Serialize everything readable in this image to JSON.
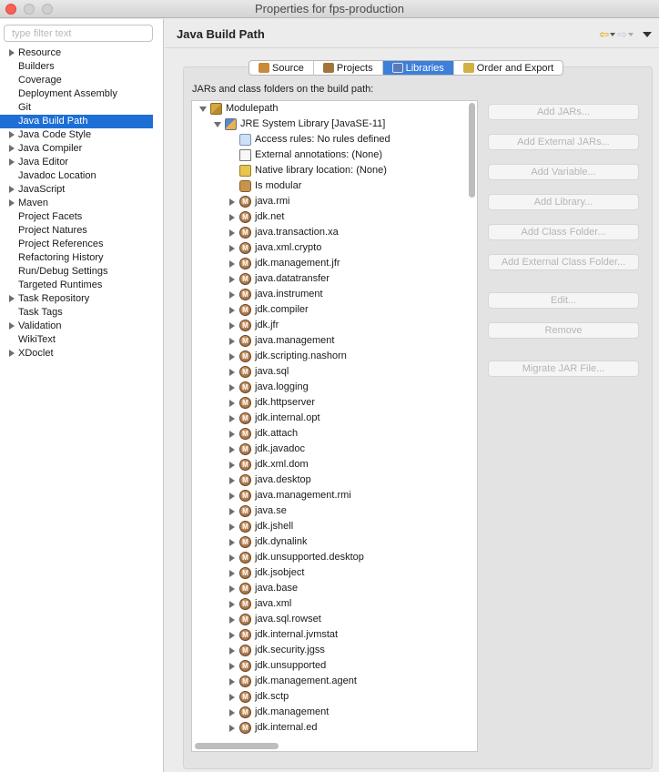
{
  "window": {
    "title": "Properties for fps-production"
  },
  "filter": {
    "placeholder": "type filter text",
    "value": ""
  },
  "nav": {
    "items": [
      {
        "label": "Resource",
        "expandable": true,
        "selected": false
      },
      {
        "label": "Builders",
        "expandable": false,
        "selected": false
      },
      {
        "label": "Coverage",
        "expandable": false,
        "selected": false
      },
      {
        "label": "Deployment Assembly",
        "expandable": false,
        "selected": false
      },
      {
        "label": "Git",
        "expandable": false,
        "selected": false
      },
      {
        "label": "Java Build Path",
        "expandable": false,
        "selected": true
      },
      {
        "label": "Java Code Style",
        "expandable": true,
        "selected": false
      },
      {
        "label": "Java Compiler",
        "expandable": true,
        "selected": false
      },
      {
        "label": "Java Editor",
        "expandable": true,
        "selected": false
      },
      {
        "label": "Javadoc Location",
        "expandable": false,
        "selected": false
      },
      {
        "label": "JavaScript",
        "expandable": true,
        "selected": false
      },
      {
        "label": "Maven",
        "expandable": true,
        "selected": false
      },
      {
        "label": "Project Facets",
        "expandable": false,
        "selected": false
      },
      {
        "label": "Project Natures",
        "expandable": false,
        "selected": false
      },
      {
        "label": "Project References",
        "expandable": false,
        "selected": false
      },
      {
        "label": "Refactoring History",
        "expandable": false,
        "selected": false
      },
      {
        "label": "Run/Debug Settings",
        "expandable": false,
        "selected": false
      },
      {
        "label": "Targeted Runtimes",
        "expandable": false,
        "selected": false
      },
      {
        "label": "Task Repository",
        "expandable": true,
        "selected": false
      },
      {
        "label": "Task Tags",
        "expandable": false,
        "selected": false
      },
      {
        "label": "Validation",
        "expandable": true,
        "selected": false
      },
      {
        "label": "WikiText",
        "expandable": false,
        "selected": false
      },
      {
        "label": "XDoclet",
        "expandable": true,
        "selected": false
      }
    ]
  },
  "page": {
    "title": "Java Build Path",
    "path_label": "JARs and class folders on the build path:"
  },
  "tabs": [
    {
      "label": "Source",
      "icon": "source-folder-icon",
      "active": false
    },
    {
      "label": "Projects",
      "icon": "projects-icon",
      "active": false
    },
    {
      "label": "Libraries",
      "icon": "libraries-icon",
      "active": true
    },
    {
      "label": "Order and Export",
      "icon": "order-export-icon",
      "active": false
    }
  ],
  "tree": {
    "root": "Modulepath",
    "jre": "JRE System Library [JavaSE-11]",
    "jre_children": [
      {
        "label": "Access rules: No rules defined",
        "icon": "access-rules-icon"
      },
      {
        "label": "External annotations: (None)",
        "icon": "annotations-icon"
      },
      {
        "label": "Native library location: (None)",
        "icon": "native-library-icon"
      },
      {
        "label": "Is modular",
        "icon": "modular-icon"
      }
    ],
    "modules": [
      "java.rmi",
      "jdk.net",
      "java.transaction.xa",
      "java.xml.crypto",
      "jdk.management.jfr",
      "java.datatransfer",
      "java.instrument",
      "jdk.compiler",
      "jdk.jfr",
      "java.management",
      "jdk.scripting.nashorn",
      "java.sql",
      "java.logging",
      "jdk.httpserver",
      "jdk.internal.opt",
      "jdk.attach",
      "jdk.javadoc",
      "jdk.xml.dom",
      "java.desktop",
      "java.management.rmi",
      "java.se",
      "jdk.jshell",
      "jdk.dynalink",
      "jdk.unsupported.desktop",
      "jdk.jsobject",
      "java.base",
      "java.xml",
      "java.sql.rowset",
      "jdk.internal.jvmstat",
      "jdk.security.jgss",
      "jdk.unsupported",
      "jdk.management.agent",
      "jdk.sctp",
      "jdk.management",
      "jdk.internal.ed"
    ]
  },
  "buttons": [
    {
      "label": "Add JARs...",
      "enabled": false
    },
    {
      "label": "Add External JARs...",
      "enabled": false
    },
    {
      "label": "Add Variable...",
      "enabled": false
    },
    {
      "label": "Add Library...",
      "enabled": false
    },
    {
      "label": "Add Class Folder...",
      "enabled": false
    },
    {
      "label": "Add External Class Folder...",
      "enabled": false
    },
    {
      "label": "Edit...",
      "enabled": false
    },
    {
      "label": "Remove",
      "enabled": false
    },
    {
      "label": "Migrate JAR File...",
      "enabled": false
    }
  ],
  "colors": {
    "selection": "#1d6fd6",
    "active_tab": "#3d7fd9",
    "close_button": "#fc5f57"
  }
}
